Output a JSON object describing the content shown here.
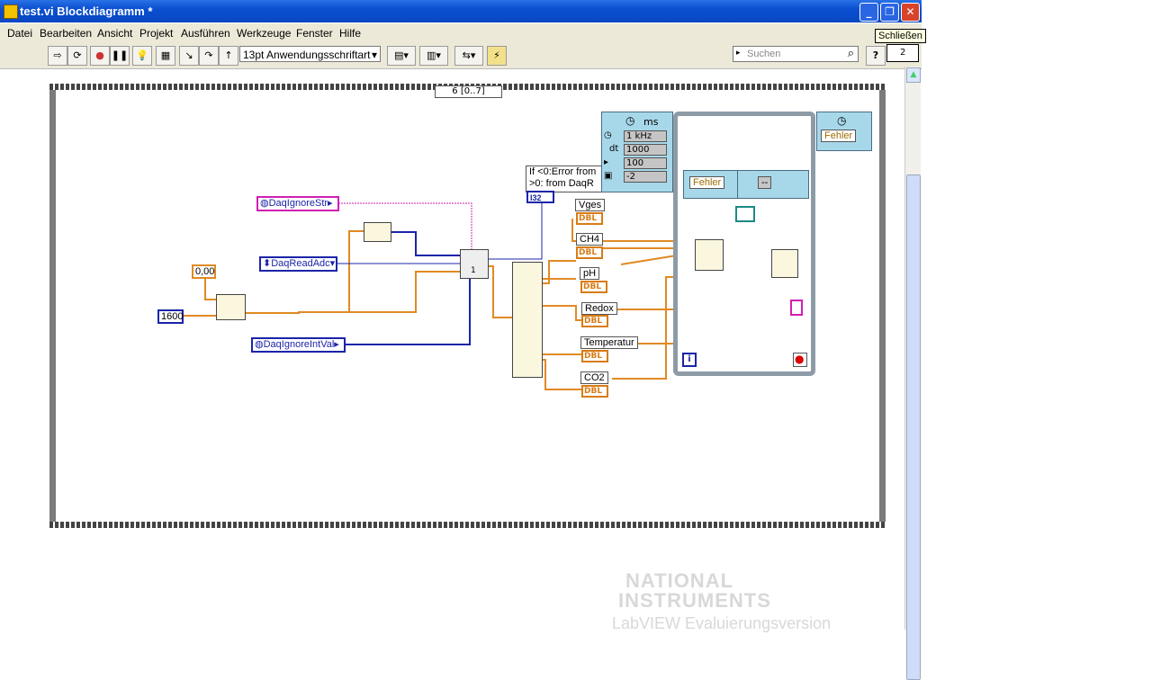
{
  "window": {
    "title": "test.vi Blockdiagramm *"
  },
  "tooltip": "Schließen",
  "menu": [
    {
      "label": "Datei"
    },
    {
      "label": "Bearbeiten"
    },
    {
      "label": "Ansicht"
    },
    {
      "label": "Projekt"
    },
    {
      "label": "Ausführen"
    },
    {
      "label": "Werkzeuge"
    },
    {
      "label": "Fenster"
    },
    {
      "label": "Hilfe"
    }
  ],
  "toolbar": {
    "font_label": "13pt Anwendungsschriftart",
    "search_placeholder": "Suchen",
    "help": "?",
    "context_num": "2"
  },
  "diagram": {
    "case_selector": "6 [0..7]",
    "consts": {
      "c0": "0,00",
      "c1600": "1600",
      "dqstr": "DaqIgnoreStr",
      "dqadc": "DaqReadAdc",
      "dqint": "DaqIgnoreIntVal"
    },
    "error_box": {
      "line1": "If <0:Error from",
      "line2": ">0:",
      "line3": "from DaqR",
      "type": "I32"
    },
    "indicators": [
      "Vges",
      "CH4",
      "pH",
      "Redox",
      "Temperatur",
      "CO2"
    ],
    "dbl": "DBL",
    "timed": {
      "unit": "ms",
      "freq": "1 kHz",
      "dt_label": "dt",
      "dt": "1000",
      "offset": "100",
      "prio": "-2"
    },
    "fehler": "Fehler",
    "dashes": "--",
    "iter": "i",
    "call_num": "1"
  },
  "watermark": {
    "line1": "NATIONAL",
    "line2": "INSTRUMENTS",
    "line3": "LabVIEW Evaluierungsversion"
  }
}
